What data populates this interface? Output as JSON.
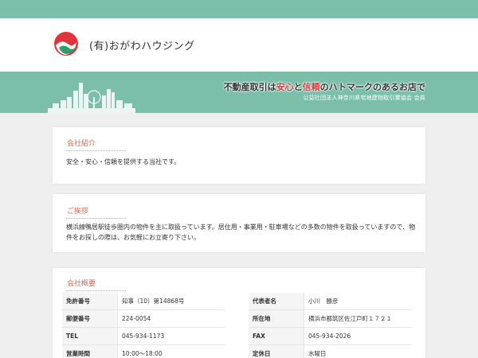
{
  "header": {
    "company_name": "(有)おがわハウジング"
  },
  "banner": {
    "tagline_part1": "不動産取引は",
    "tagline_hl1": "安心",
    "tagline_part2": "と",
    "tagline_hl2": "信頼",
    "tagline_part3": "のハトマークのあるお店で",
    "subtitle": "公益社団法人神奈川県宅地建物取引業協会 会員"
  },
  "intro": {
    "title": "会社紹介",
    "text": "安全・安心・信頼を提供する当社です。"
  },
  "greeting": {
    "title": "ご挨拶",
    "text": "横浜線鴨居駅徒歩圏内の物件を主に取扱っています。居住用・事業用・駐車場などの多数の物件を取扱っていますので、物件をお探しの際は、お気軽にお立寄り下さい。"
  },
  "overview": {
    "title": "会社概要",
    "left": [
      {
        "label": "免許番号",
        "value": "知事（10）第14868号"
      },
      {
        "label": "郵便番号",
        "value": "224-0054"
      },
      {
        "label": "TEL",
        "value": "045-934-1173"
      },
      {
        "label": "営業時間",
        "value": "10:00～18:00"
      }
    ],
    "right": [
      {
        "label": "代表者名",
        "value": "小川　勝彦"
      },
      {
        "label": "所在地",
        "value": "横浜市都筑区佐江戸町１７２１"
      },
      {
        "label": "FAX",
        "value": "045-934-2026"
      },
      {
        "label": "定休日",
        "value": "水曜日"
      }
    ]
  },
  "colors": {
    "brand_green": "#7bbfab",
    "accent_red": "#d63a3a",
    "title_color": "#d36b5a"
  }
}
